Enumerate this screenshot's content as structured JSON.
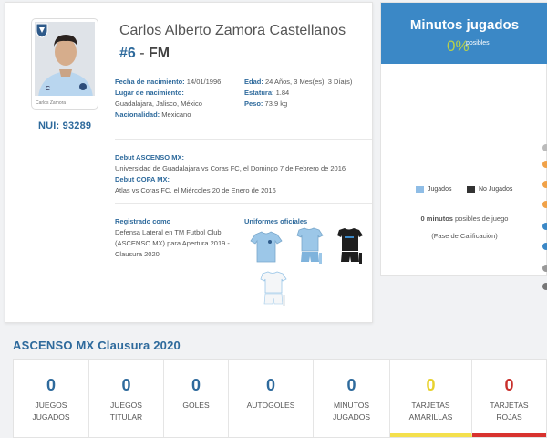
{
  "player": {
    "name": "Carlos Alberto Zamora Castellanos",
    "number": "#6",
    "separator": " - ",
    "position": "FM",
    "nui": "NUI: 93289",
    "photo_caption": "Carlos Zamora"
  },
  "info": {
    "birth_date_label": "Fecha de nacimiento:",
    "birth_date": "14/01/1996",
    "birth_place_label": "Lugar de nacimiento:",
    "birth_place": "Guadalajara, Jalisco, México",
    "nationality_label": "Nacionalidad:",
    "nationality": "Mexicano",
    "age_label": "Edad:",
    "age": "24 Años, 3 Mes(es), 3 Día(s)",
    "height_label": "Estatura:",
    "height": "1.84",
    "weight_label": "Peso:",
    "weight": "73.9 kg"
  },
  "debuts": {
    "ascenso_label": "Debut ASCENSO MX:",
    "ascenso_text": "Universidad de Guadalajara vs Coras FC, el Domingo 7 de Febrero de 2016",
    "copa_label": "Debut COPA MX:",
    "copa_text": "Atlas vs Coras FC, el Miércoles 20 de Enero de 2016"
  },
  "registration": {
    "label": "Registrado como",
    "line1": "Defensa Lateral en TM Futbol Club",
    "line2": "(ASCENSO MX) para Apertura 2019 -",
    "line3": "Clausura 2020"
  },
  "uniforms": {
    "label": "Uniformes oficiales",
    "kits": [
      {
        "name": "kit-home",
        "shirt": "#9cc7e8",
        "shorts": "#9cc7e8"
      },
      {
        "name": "kit-home-2",
        "shirt": "#9cc7e8",
        "shorts": "#7fb3dc"
      },
      {
        "name": "kit-away",
        "shirt": "#1e1e1e",
        "shorts": "#1e1e1e"
      },
      {
        "name": "kit-third",
        "shirt": "#f4f6f8",
        "shorts": "#f4f6f8"
      }
    ]
  },
  "minutes": {
    "title": "Minutos jugados",
    "percent": "0%",
    "percent_suffix": "posibles",
    "legend_played": "Jugados",
    "legend_not_played": "No Jugados",
    "minutes_value": "0 minutos",
    "minutes_suffix": " posibles de juego",
    "phase": "(Fase de Calificación)",
    "colors": {
      "played": "#8fbde6",
      "not_played": "#333333",
      "header": "#3b88c6",
      "percent": "#b8d04a"
    }
  },
  "season": {
    "title": "ASCENSO MX Clausura 2020",
    "stats": [
      {
        "value": "0",
        "line1": "JUEGOS",
        "line2": "JUGADOS"
      },
      {
        "value": "0",
        "line1": "JUEGOS",
        "line2": "TITULAR"
      },
      {
        "value": "0",
        "line1": "GOLES",
        "line2": ""
      },
      {
        "value": "0",
        "line1": "AUTOGOLES",
        "line2": ""
      },
      {
        "value": "0",
        "line1": "MINUTOS",
        "line2": "JUGADOS"
      },
      {
        "value": "0",
        "line1": "TARJETAS",
        "line2": "AMARILLAS"
      },
      {
        "value": "0",
        "line1": "TARJETAS",
        "line2": "ROJAS"
      }
    ]
  }
}
